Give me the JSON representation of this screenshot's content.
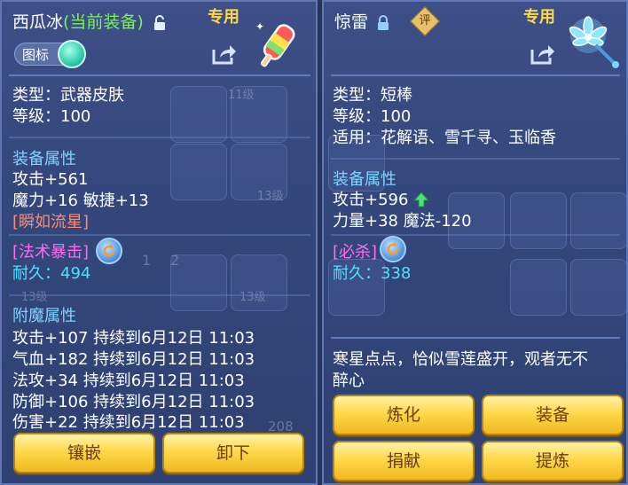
{
  "left": {
    "name": "西瓜冰",
    "status": "(当前装备)",
    "exclusive": "专用",
    "icon_toggle_label": "图标",
    "type_line": "类型：武器皮肤",
    "level_line": "等级：100",
    "equip_attr_header": "装备属性",
    "attrs": [
      "攻击+561",
      "魔力+16 敏捷+13"
    ],
    "special": "[瞬如流星]",
    "skill": "[法术暴击]",
    "durability_label": "耐久：",
    "durability_value": "494",
    "enchant_header": "附魔属性",
    "enchants": [
      "攻击+107 持续到6月12日 11:03",
      "气血+182 持续到6月12日 11:03",
      "法攻+34 持续到6月12日 11:03",
      "防御+106 持续到6月12日 11:03",
      "伤害+22 持续到6月12日 11:03"
    ],
    "buttons": [
      "镶嵌",
      "卸下"
    ],
    "bg_texts": [
      "11级",
      "13级",
      "13级",
      "13级",
      "1",
      "2",
      "208"
    ]
  },
  "right": {
    "name": "惊雷",
    "eval_badge": "评",
    "exclusive": "专用",
    "type_line": "类型：短棒",
    "level_line": "等级：100",
    "fit_line": "适用：花解语、雪千寻、玉临香",
    "equip_attr_header": "装备属性",
    "attrs": [
      "攻击+596",
      "力量+38 魔法-120"
    ],
    "skill": "[必杀]",
    "durability_label": "耐久：",
    "durability_value": "338",
    "description_1": "寒星点点，恰似雪莲盛开，观者无不",
    "description_2": "醉心",
    "buttons": [
      "炼化",
      "装备",
      "捐献",
      "提炼"
    ]
  },
  "colors": {
    "panel": "#34477c",
    "border": "#5f77b4",
    "gold_button": "#ffd84a",
    "section_blue": "#7fd3ff",
    "green_status": "#7bf05b",
    "skill_pink": "#ff6bf0",
    "special_red": "#ff8a6e",
    "durability_cyan": "#4fe0ff",
    "exclusive_gold": "#ffd848"
  },
  "icons": [
    "lock-icon",
    "share-icon",
    "refresh-icon",
    "up-arrow-icon",
    "popsicle-weapon-icon",
    "lotus-wand-icon",
    "toggle-knob-icon"
  ]
}
